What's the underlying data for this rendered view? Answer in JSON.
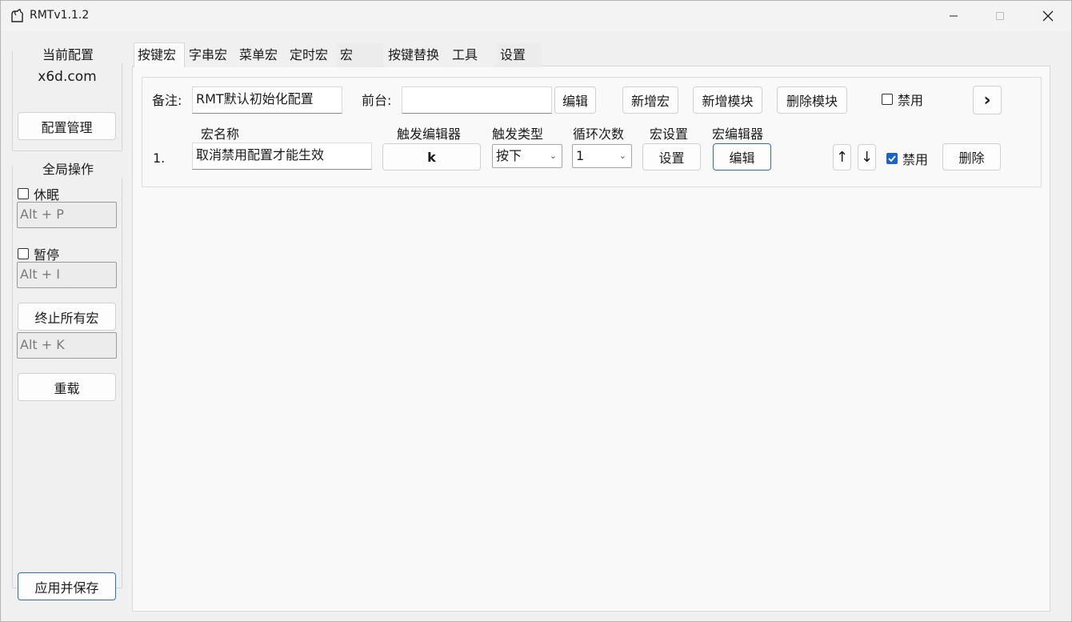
{
  "window": {
    "title": "RMTv1.1.2",
    "icons": {
      "app": "app-icon",
      "minimize": "minimize-icon",
      "maximize": "maximize-icon",
      "close": "close-icon"
    }
  },
  "sidebar": {
    "current_config_title": "当前配置",
    "current_config_name": "x6d.com",
    "config_manage_label": "配置管理",
    "global_ops_title": "全局操作",
    "sleep": {
      "label": "休眠",
      "checked": false,
      "hotkey": "Alt + P"
    },
    "pause": {
      "label": "暂停",
      "checked": false,
      "hotkey": "Alt + I"
    },
    "stop_all_label": "终止所有宏",
    "stop_all_hotkey": "Alt + K",
    "reload_label": "重载",
    "apply_save_label": "应用并保存"
  },
  "tabs": [
    {
      "label": "按键宏",
      "active": true
    },
    {
      "label": "字串宏",
      "active": false
    },
    {
      "label": "菜单宏",
      "active": false
    },
    {
      "label": "定时宏",
      "active": false
    },
    {
      "label": "宏",
      "active": false
    },
    {
      "label": "按键替换",
      "active": false
    },
    {
      "label": "工具",
      "active": false
    },
    {
      "label": "设置",
      "active": false
    }
  ],
  "module": {
    "note_label": "备注:",
    "note_value": "RMT默认初始化配置",
    "foreground_label": "前台:",
    "foreground_value": "",
    "edit_label": "编辑",
    "new_macro_label": "新增宏",
    "new_module_label": "新增模块",
    "delete_module_label": "删除模块",
    "disable_label": "禁用",
    "disable_checked": false,
    "next_label": "›"
  },
  "columns": {
    "macro_name": "宏名称",
    "trigger_editor": "触发编辑器",
    "trigger_type": "触发类型",
    "loop_count": "循环次数",
    "macro_settings": "宏设置",
    "macro_editor": "宏编辑器"
  },
  "rows": [
    {
      "index": "1.",
      "name": "取消禁用配置才能生效",
      "trigger_key": "k",
      "trigger_type": "按下",
      "loop": "1",
      "settings_label": "设置",
      "editor_label": "编辑",
      "up_label": "↑",
      "down_label": "↓",
      "disable_label": "禁用",
      "disable_checked": true,
      "delete_label": "删除"
    }
  ],
  "colors": {
    "accent": "#1a64c4",
    "primary_border": "#2a6fb8"
  }
}
